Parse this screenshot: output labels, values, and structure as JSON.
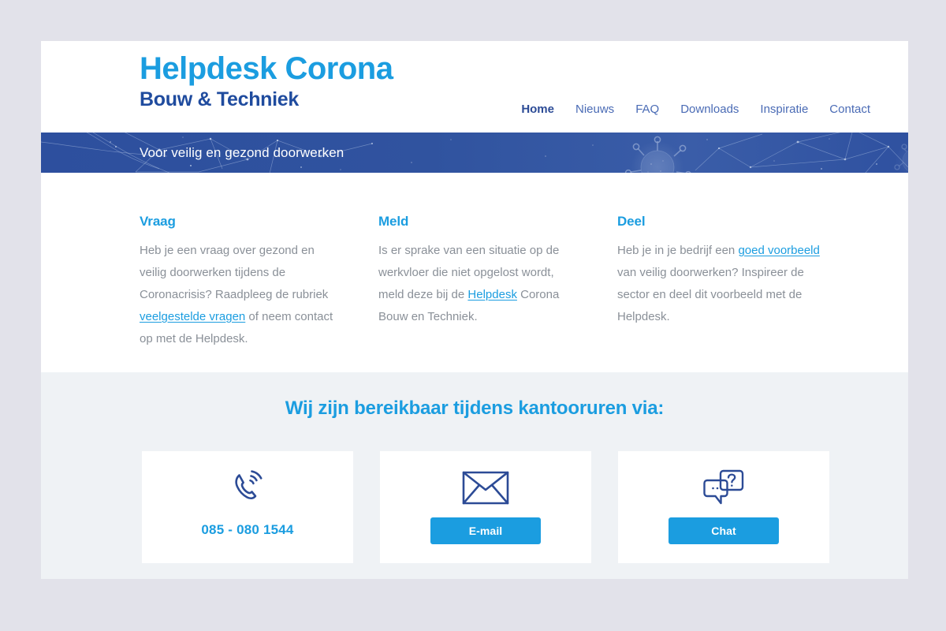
{
  "colors": {
    "page_background": "#e2e2ea",
    "accent_light_blue": "#1b9de0",
    "accent_dark_blue": "#1f4b9e",
    "banner_blue": "#2d4f9e",
    "contact_band": "#eff2f5",
    "body_text": "#8a9098"
  },
  "header": {
    "brand_line1": "Helpdesk Corona",
    "brand_line2": "Bouw & Techniek",
    "nav": [
      {
        "label": "Home",
        "active": true
      },
      {
        "label": "Nieuws",
        "active": false
      },
      {
        "label": "FAQ",
        "active": false
      },
      {
        "label": "Downloads",
        "active": false
      },
      {
        "label": "Inspiratie",
        "active": false
      },
      {
        "label": "Contact",
        "active": false
      }
    ]
  },
  "banner": {
    "tagline": "Voor veilig en gezond doorwerken",
    "artwork": "coronavirus-network-pattern"
  },
  "intro": {
    "columns": [
      {
        "title": "Vraag",
        "segments": [
          {
            "text": "Heb je een vraag over gezond en veilig doorwerken tijdens de Coronacrisis? Raadpleeg de rubriek ",
            "link": false
          },
          {
            "text": "veelgestelde vragen",
            "link": true
          },
          {
            "text": " of neem contact op met de Helpdesk.",
            "link": false
          }
        ]
      },
      {
        "title": "Meld",
        "segments": [
          {
            "text": "Is er sprake van een situatie op de werkvloer die niet opgelost wordt, meld deze bij de ",
            "link": false
          },
          {
            "text": "Helpdesk",
            "link": true
          },
          {
            "text": " Corona Bouw en Techniek.",
            "link": false
          }
        ]
      },
      {
        "title": "Deel",
        "segments": [
          {
            "text": "Heb je in je bedrijf een ",
            "link": false
          },
          {
            "text": "goed voorbeeld",
            "link": true
          },
          {
            "text": " van veilig doorwerken? Inspireer de sector en deel dit voorbeeld met de Helpdesk.",
            "link": false
          }
        ]
      }
    ]
  },
  "contact": {
    "title": "Wij zijn bereikbaar tijdens kantooruren via:",
    "cards": [
      {
        "icon": "phone-icon",
        "type": "phone",
        "value": "085 - 080 1544"
      },
      {
        "icon": "envelope-icon",
        "type": "button",
        "button_label": "E-mail"
      },
      {
        "icon": "chat-bubbles-icon",
        "type": "button",
        "button_label": "Chat"
      }
    ]
  }
}
